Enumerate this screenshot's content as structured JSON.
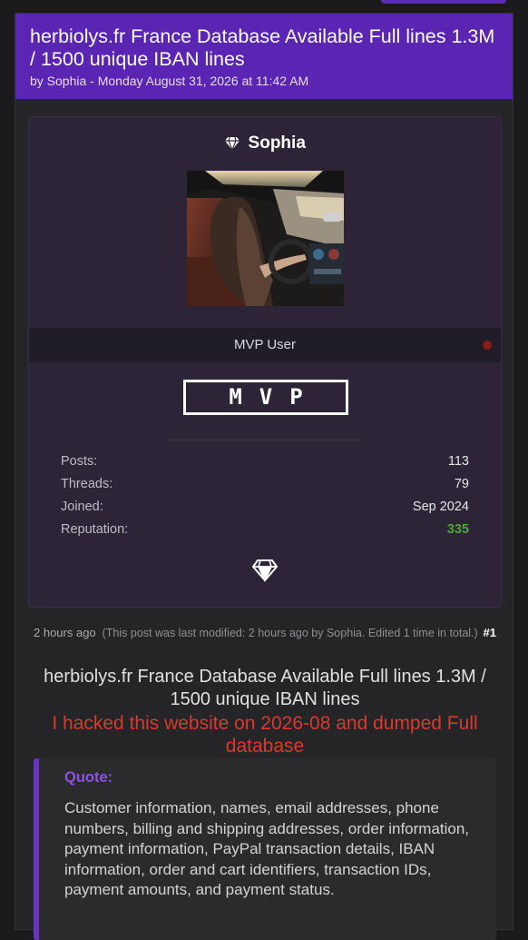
{
  "thread": {
    "title": "herbiolys.fr France Database Available Full lines 1.3M / 1500 unique IBAN lines",
    "byline": "by Sophia - Monday August 31, 2026 at 11:42 AM"
  },
  "user": {
    "name": "Sophia",
    "role": "MVP User",
    "badge": "MVP",
    "icons": {
      "name_icon": "diamond-icon",
      "card_icon": "diamond-icon"
    },
    "stats": [
      {
        "label": "Posts:",
        "value": "113"
      },
      {
        "label": "Threads:",
        "value": "79"
      },
      {
        "label": "Joined:",
        "value": "Sep 2024"
      },
      {
        "label": "Reputation:",
        "value": "335"
      }
    ]
  },
  "post": {
    "time": "2 hours ago",
    "modified": "(This post was last modified: 2 hours ago by Sophia. Edited 1 time in total.)",
    "number": "#1",
    "title": "herbiolys.fr France Database Available Full lines 1.3M / 1500 unique IBAN lines",
    "hack_line": "I hacked this website on 2026-08 and dumped Full database",
    "quote_label": "Quote:",
    "quote_text": "Customer information, names, email addresses, phone numbers, billing and shipping addresses, order information, payment information, PayPal transaction details, IBAN information, order and cart identifiers, transaction IDs, payment amounts, and payment status."
  },
  "colors": {
    "accent": "#5b25b4",
    "reputation": "#4ca63a",
    "alert_text": "#d83a2f",
    "quote_label": "#8b53e0"
  }
}
